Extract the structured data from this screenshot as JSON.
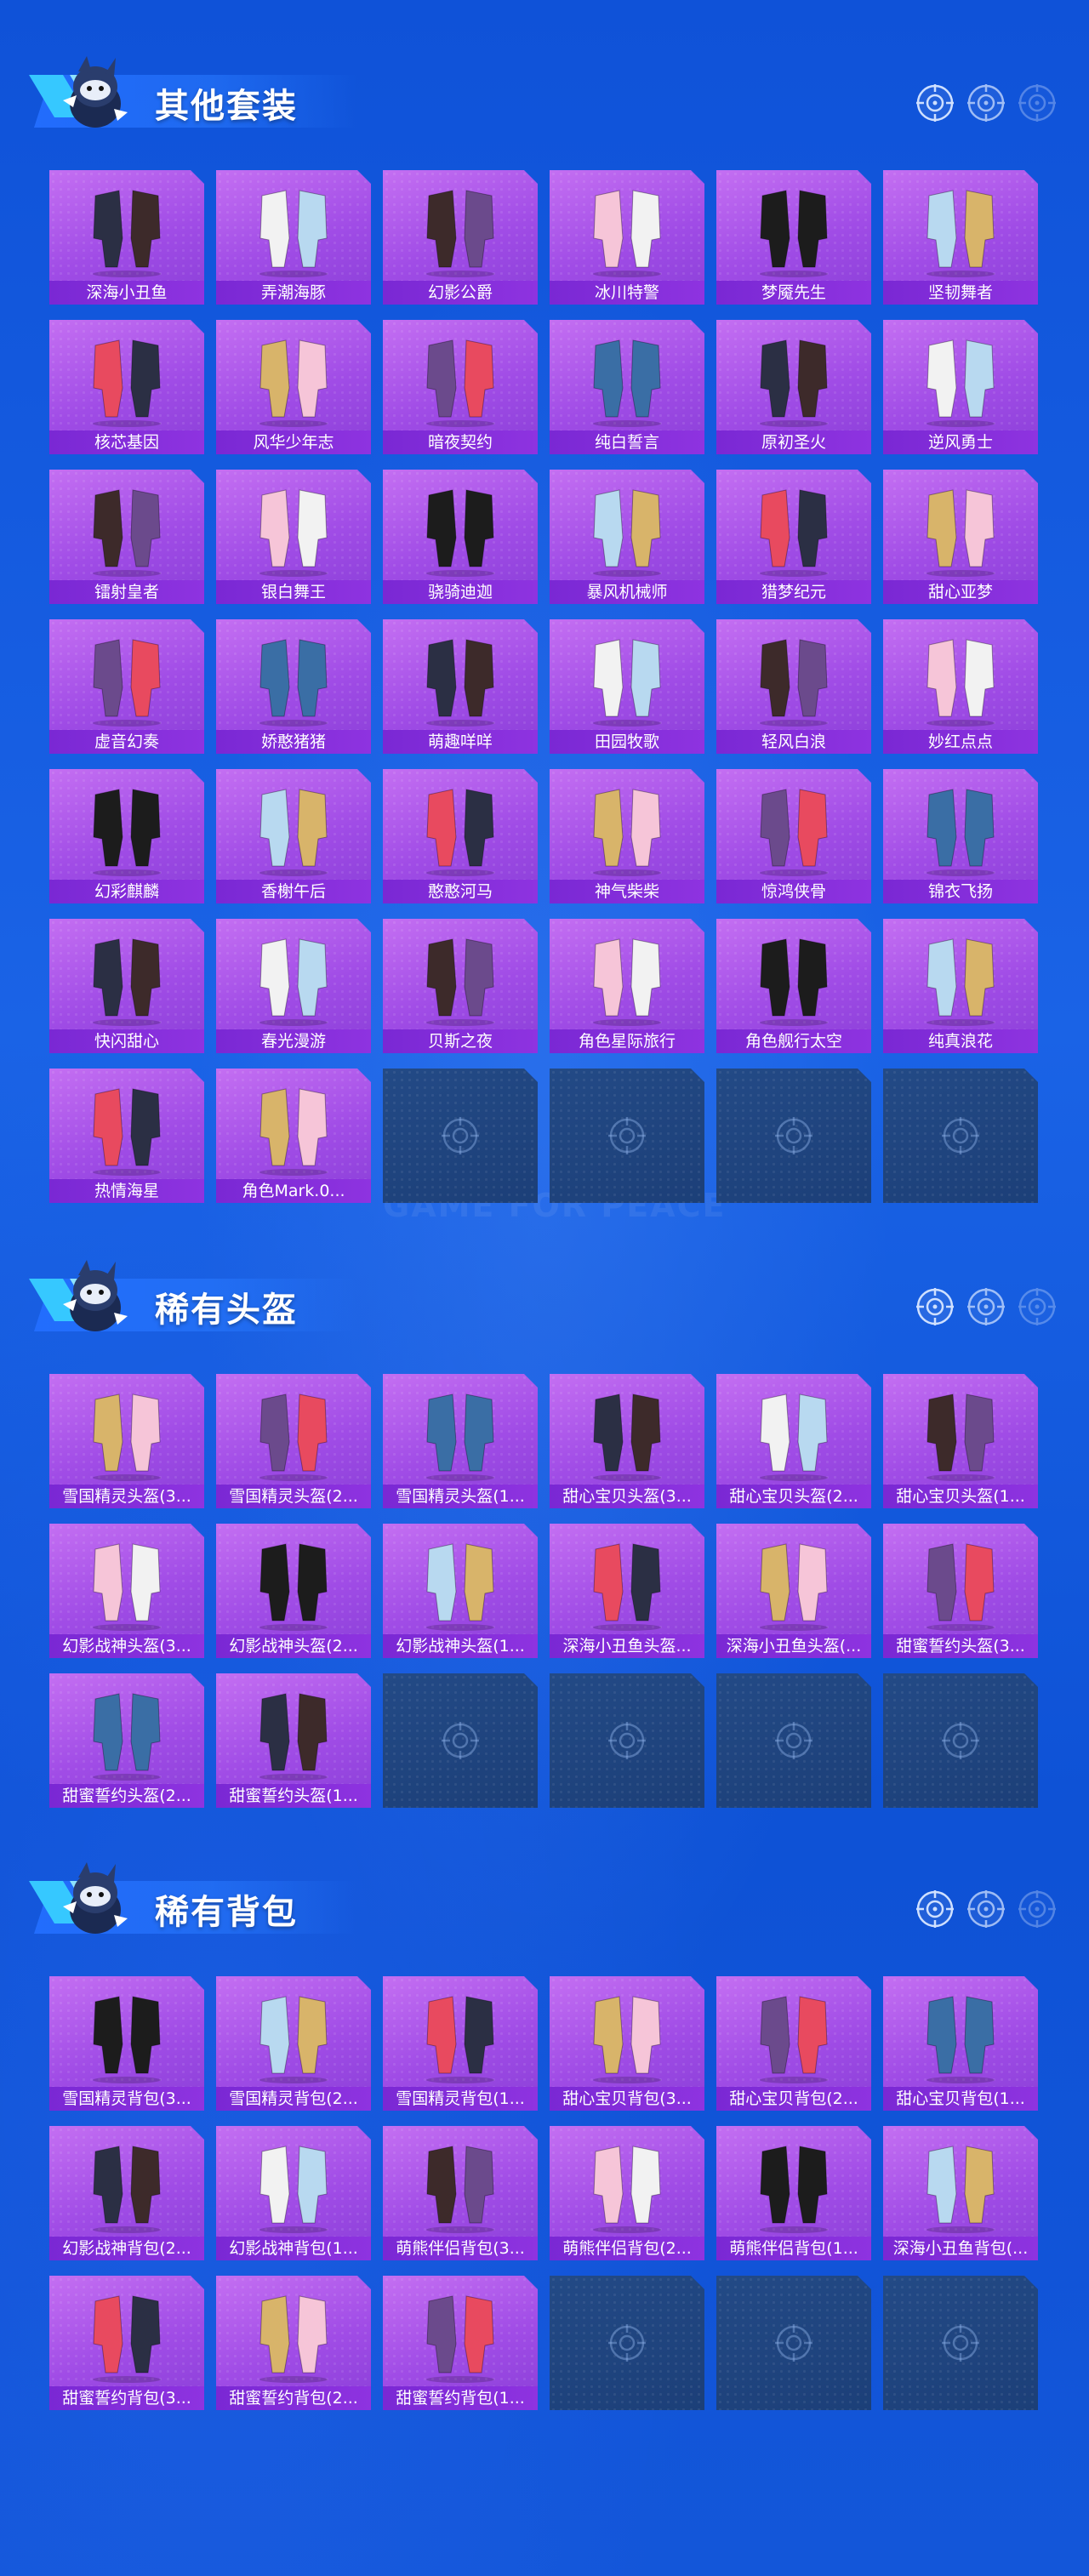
{
  "watermark": "GAME FOR PEACE",
  "sections": [
    {
      "title": "其他套装",
      "items": [
        "深海小丑鱼",
        "弄潮海豚",
        "幻影公爵",
        "冰川特警",
        "梦魇先生",
        "坚韧舞者",
        "核芯基因",
        "风华少年志",
        "暗夜契约",
        "纯白誓言",
        "原初圣火",
        "逆风勇士",
        "镭射皇者",
        "银白舞王",
        "骁骑迪迦",
        "暴风机械师",
        "猎梦纪元",
        "甜心亚梦",
        "虚音幻奏",
        "娇憨猪猪",
        "萌趣咩咩",
        "田园牧歌",
        "轻风白浪",
        "妙红点点",
        "幻彩麒麟",
        "香榭午后",
        "憨憨河马",
        "神气柴柴",
        "惊鸿侠骨",
        "锦衣飞扬",
        "快闪甜心",
        "春光漫游",
        "贝斯之夜",
        "角色星际旅行",
        "角色舰行太空",
        "纯真浪花",
        "热情海星",
        "角色Mark.0..."
      ],
      "empty_slots": 4
    },
    {
      "title": "稀有头盔",
      "items": [
        "雪国精灵头盔(3...",
        "雪国精灵头盔(2...",
        "雪国精灵头盔(1...",
        "甜心宝贝头盔(3...",
        "甜心宝贝头盔(2...",
        "甜心宝贝头盔(1...",
        "幻影战神头盔(3...",
        "幻影战神头盔(2...",
        "幻影战神头盔(1...",
        "深海小丑鱼头盔...",
        "深海小丑鱼头盔(...",
        "甜蜜誓约头盔(3...",
        "甜蜜誓约头盔(2...",
        "甜蜜誓约头盔(1..."
      ],
      "empty_slots": 4
    },
    {
      "title": "稀有背包",
      "items": [
        "雪国精灵背包(3...",
        "雪国精灵背包(2...",
        "雪国精灵背包(1...",
        "甜心宝贝背包(3...",
        "甜心宝贝背包(2...",
        "甜心宝贝背包(1...",
        "幻影战神背包(2...",
        "幻影战神背包(1...",
        "萌熊伴侣背包(3...",
        "萌熊伴侣背包(2...",
        "萌熊伴侣背包(1...",
        "深海小丑鱼背包(...",
        "甜蜜誓约背包(3...",
        "甜蜜誓约背包(2...",
        "甜蜜誓约背包(1..."
      ],
      "empty_slots": 3
    }
  ],
  "colors": {
    "card": "#a04ce6",
    "label": "#7a28d4",
    "empty": "#1c3f78",
    "bg": "#1356d9"
  }
}
